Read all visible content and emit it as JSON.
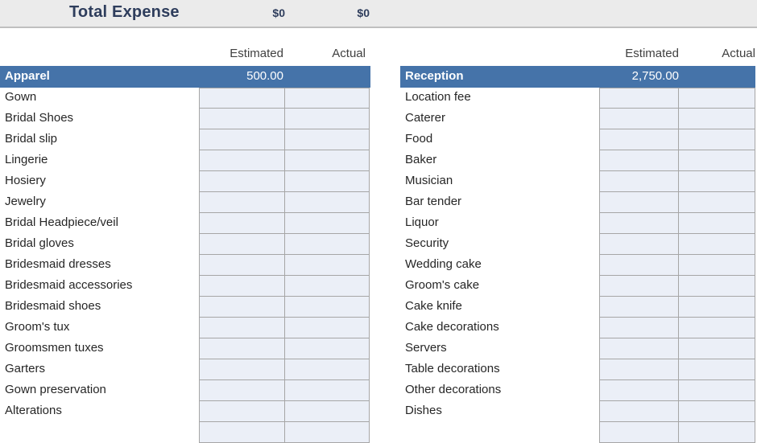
{
  "total_bar": {
    "title": "Total Expense",
    "estimated_total": "$0",
    "actual_total": "$0"
  },
  "colors": {
    "section_header_bg": "#4573a9",
    "section_header_text": "#ffffff",
    "input_cell_bg": "#ebeff7",
    "cell_border": "#a6a6a6",
    "total_bar_bg": "#ebebeb",
    "title_text": "#2e3d5c",
    "body_text": "#262626"
  },
  "columns": {
    "estimated_label": "Estimated",
    "actual_label": "Actual"
  },
  "sections": [
    {
      "id": "apparel",
      "name": "Apparel",
      "estimated": "500.00",
      "actual": "",
      "items": [
        {
          "name": "Gown",
          "estimated": "",
          "actual": ""
        },
        {
          "name": "Bridal Shoes",
          "estimated": "",
          "actual": ""
        },
        {
          "name": "Bridal slip",
          "estimated": "",
          "actual": ""
        },
        {
          "name": "Lingerie",
          "estimated": "",
          "actual": ""
        },
        {
          "name": "Hosiery",
          "estimated": "",
          "actual": ""
        },
        {
          "name": "Jewelry",
          "estimated": "",
          "actual": ""
        },
        {
          "name": "Bridal Headpiece/veil",
          "estimated": "",
          "actual": ""
        },
        {
          "name": "Bridal gloves",
          "estimated": "",
          "actual": ""
        },
        {
          "name": "Bridesmaid dresses",
          "estimated": "",
          "actual": ""
        },
        {
          "name": "Bridesmaid accessories",
          "estimated": "",
          "actual": ""
        },
        {
          "name": "Bridesmaid shoes",
          "estimated": "",
          "actual": ""
        },
        {
          "name": "Groom's tux",
          "estimated": "",
          "actual": ""
        },
        {
          "name": "Groomsmen tuxes",
          "estimated": "",
          "actual": ""
        },
        {
          "name": "Garters",
          "estimated": "",
          "actual": ""
        },
        {
          "name": "Gown preservation",
          "estimated": "",
          "actual": ""
        },
        {
          "name": "Alterations",
          "estimated": "",
          "actual": ""
        },
        {
          "name": "",
          "estimated": "",
          "actual": ""
        }
      ]
    },
    {
      "id": "reception",
      "name": "Reception",
      "estimated": "2,750.00",
      "actual": "",
      "items": [
        {
          "name": "Location fee",
          "estimated": "",
          "actual": ""
        },
        {
          "name": "Caterer",
          "estimated": "",
          "actual": ""
        },
        {
          "name": "Food",
          "estimated": "",
          "actual": ""
        },
        {
          "name": "Baker",
          "estimated": "",
          "actual": ""
        },
        {
          "name": "Musician",
          "estimated": "",
          "actual": ""
        },
        {
          "name": "Bar tender",
          "estimated": "",
          "actual": ""
        },
        {
          "name": "Liquor",
          "estimated": "",
          "actual": ""
        },
        {
          "name": "Security",
          "estimated": "",
          "actual": ""
        },
        {
          "name": "Wedding cake",
          "estimated": "",
          "actual": ""
        },
        {
          "name": "Groom's cake",
          "estimated": "",
          "actual": ""
        },
        {
          "name": "Cake knife",
          "estimated": "",
          "actual": ""
        },
        {
          "name": "Cake decorations",
          "estimated": "",
          "actual": ""
        },
        {
          "name": "Servers",
          "estimated": "",
          "actual": ""
        },
        {
          "name": "Table decorations",
          "estimated": "",
          "actual": ""
        },
        {
          "name": "Other decorations",
          "estimated": "",
          "actual": ""
        },
        {
          "name": "Dishes",
          "estimated": "",
          "actual": ""
        },
        {
          "name": "",
          "estimated": "",
          "actual": ""
        }
      ]
    }
  ]
}
